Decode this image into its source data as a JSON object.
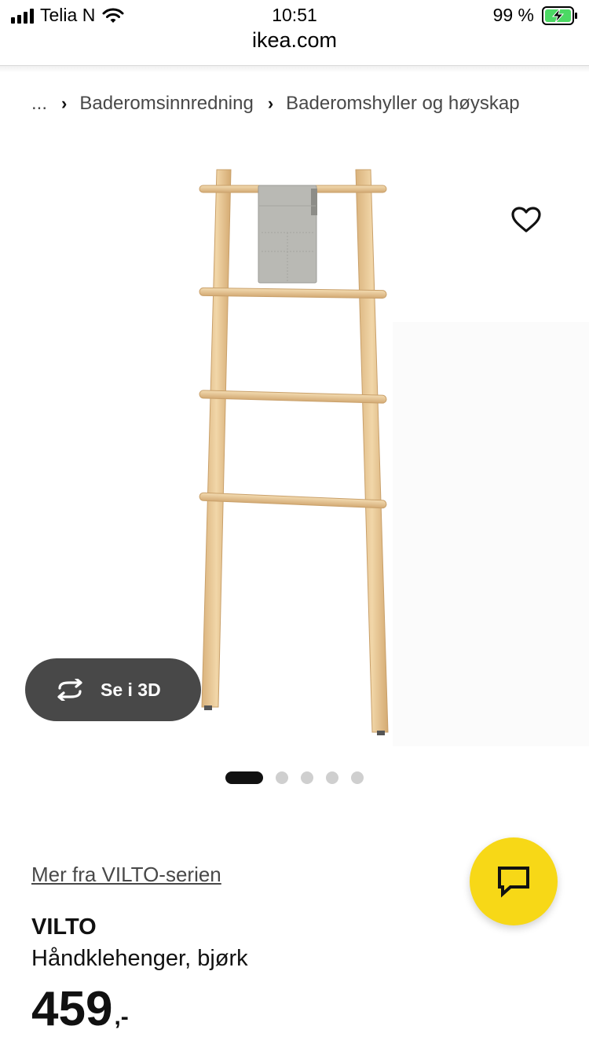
{
  "status_bar": {
    "carrier": "Telia N",
    "time": "10:51",
    "battery": "99 %"
  },
  "browser": {
    "url": "ikea.com"
  },
  "breadcrumb": {
    "ellipsis": "...",
    "items": [
      "Baderomsinnredning",
      "Baderomshyller og høyskap"
    ]
  },
  "gallery": {
    "button_3d_label": "Se i 3D",
    "dot_count": 5,
    "active_dot": 1
  },
  "product": {
    "series_link": "Mer fra VILTO-serien",
    "name": "VILTO",
    "description": "Håndklehenger, bjørk",
    "price": "459",
    "price_suffix": ",-"
  },
  "colors": {
    "ikea_yellow": "#f7d817",
    "button_dark": "#484848",
    "wood": "#e8c896"
  },
  "icons": {
    "favourite": "heart-outline-icon",
    "view_3d": "rotate-3d-icon",
    "chat": "chat-bubble-icon"
  }
}
